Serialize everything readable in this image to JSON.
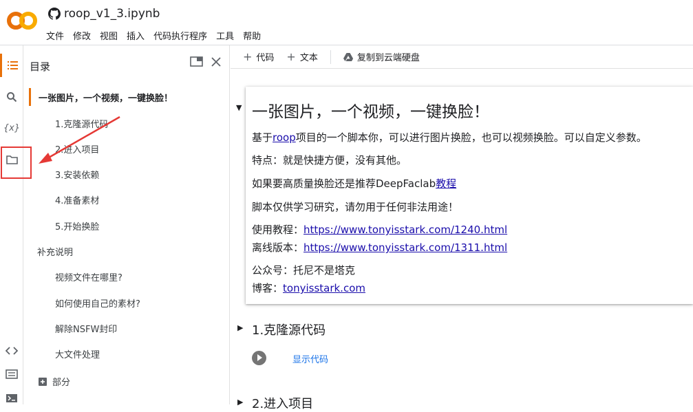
{
  "app": {
    "notebook_title": "roop_v1_3.ipynb",
    "logo_text": "CO",
    "brand_colors": {
      "logo_orange": "#f9ab00",
      "logo_dark_orange": "#e8710a",
      "link": "#1a0dab",
      "annotation_red": "#e53935"
    }
  },
  "menu": [
    "文件",
    "修改",
    "视图",
    "插入",
    "代码执行程序",
    "工具",
    "帮助"
  ],
  "toolbar": {
    "add_code": "代码",
    "add_text": "文本",
    "copy_to_drive": "复制到云端硬盘"
  },
  "rail_icons": [
    "toc-icon",
    "search-icon",
    "variables-icon",
    "folder-icon",
    "code-snippets-icon",
    "command-palette-icon",
    "terminal-icon"
  ],
  "rail_variables_label": "{x}",
  "toc": {
    "title": "目录",
    "items": [
      {
        "label": "一张图片，一个视频，一键换脸！",
        "level": 1,
        "active": true
      },
      {
        "label": "1.克隆源代码",
        "level": 2
      },
      {
        "label": "2.进入项目",
        "level": 2
      },
      {
        "label": "3.安装依赖",
        "level": 2
      },
      {
        "label": "4.准备素材",
        "level": 2
      },
      {
        "label": "5.开始换脸",
        "level": 2
      },
      {
        "label": "补充说明",
        "level": 1
      },
      {
        "label": "视频文件在哪里?",
        "level": 2
      },
      {
        "label": "如何使用自己的素材?",
        "level": 2
      },
      {
        "label": "解除NSFW封印",
        "level": 2
      },
      {
        "label": "大文件处理",
        "level": 2
      }
    ],
    "add_section": "部分"
  },
  "cell": {
    "heading": "一张图片，一个视频，一键换脸！",
    "intro_prefix": "基于",
    "intro_link": "roop",
    "intro_suffix": "项目的一个脚本你，可以进行图片换脸，也可以视频换脸。可以自定义参数。",
    "feature": "特点：就是快捷方便，没有其他。",
    "hq_prefix": "如果要高质量换脸还是推荐DeepFaclab",
    "hq_link": "教程",
    "disclaimer": "脚本仅供学习研究，请勿用于任何非法用途！",
    "tutorial_label": "使用教程：",
    "tutorial_url": "https://www.tonyisstark.com/1240.html",
    "offline_label": "离线版本：",
    "offline_url": "https://www.tonyisstark.com/1311.html",
    "wechat": "公众号：托尼不是塔克",
    "blog_label": "博客：",
    "blog_url": "tonyisstark.com"
  },
  "sections": [
    {
      "title": "1.克隆源代码",
      "show_code": "显示代码"
    },
    {
      "title": "2.进入项目"
    }
  ]
}
